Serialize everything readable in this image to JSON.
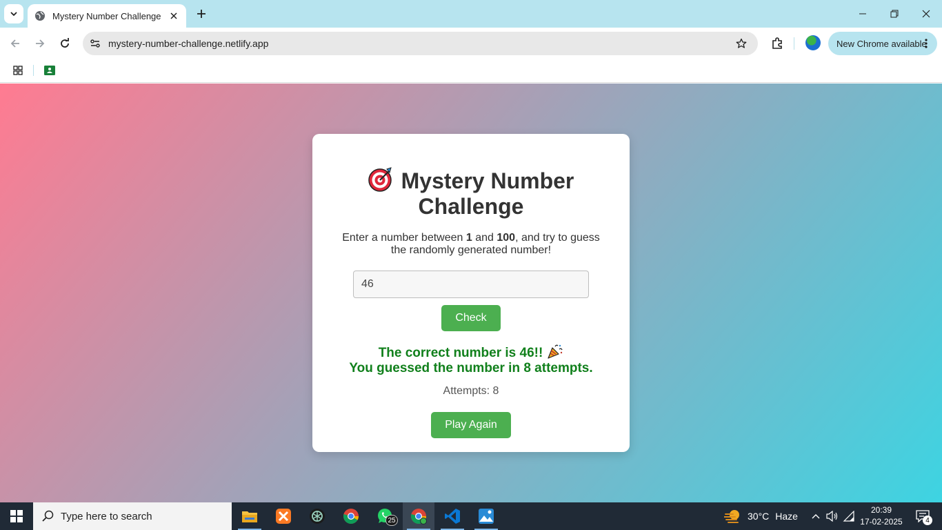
{
  "browser": {
    "tab_title": "Mystery Number Challenge",
    "url": "mystery-number-challenge.netlify.app",
    "update_label": "New Chrome available"
  },
  "game": {
    "title": "Mystery Number Challenge",
    "instruction_pre": "Enter a number between ",
    "min": "1",
    "instruction_and": " and ",
    "max": "100",
    "instruction_post": ", and try to guess the randomly generated number!",
    "guess_value": "46",
    "check_label": "Check",
    "result_line1": "The correct number is 46!!",
    "result_line2": "You guessed the number in 8 attempts.",
    "attempts_text": "Attempts: 8",
    "play_again_label": "Play Again"
  },
  "taskbar": {
    "search_placeholder": "Type here to search",
    "whatsapp_badge": "25",
    "weather_temp": "30°C",
    "weather_condition": "Haze",
    "time": "20:39",
    "date": "17-02-2025",
    "notification_count": "4"
  },
  "colors": {
    "success_green": "#11801c",
    "button_green": "#4caf50",
    "gradient_start": "#ff7b91",
    "gradient_end": "#3dd4e2"
  }
}
